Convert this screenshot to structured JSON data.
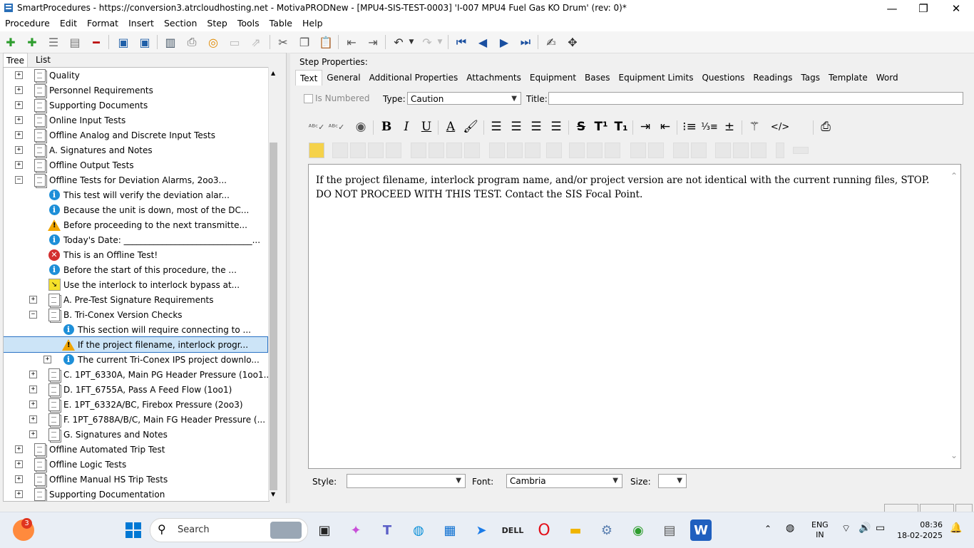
{
  "window": {
    "title": "SmartProcedures - https://conversion3.atrcloudhosting.net - MotivaPRODNew - [MPU4-SIS-TEST-0003] 'I-007 MPU4 Fuel Gas KO Drum' (rev: 0)*",
    "minimize": "—",
    "maximize": "❐",
    "close": "✕"
  },
  "menu": [
    "Procedure",
    "Edit",
    "Format",
    "Insert",
    "Section",
    "Step",
    "Tools",
    "Table",
    "Help"
  ],
  "left_tabs": {
    "tree": "Tree",
    "list": "List"
  },
  "tree": [
    {
      "label": "Quality",
      "level": 0,
      "icon": "doc",
      "exp": "+"
    },
    {
      "label": "Personnel Requirements",
      "level": 0,
      "icon": "doc",
      "exp": "+"
    },
    {
      "label": "Supporting Documents",
      "level": 0,
      "icon": "doc",
      "exp": "+"
    },
    {
      "label": "Online Input Tests",
      "level": 0,
      "icon": "doc",
      "exp": "+"
    },
    {
      "label": "Offline Analog and Discrete Input Tests",
      "level": 0,
      "icon": "doc",
      "exp": "+"
    },
    {
      "label": "A. Signatures and Notes",
      "level": 0,
      "icon": "doc",
      "exp": "+"
    },
    {
      "label": "Offline Output Tests",
      "level": 0,
      "icon": "doc",
      "exp": "+"
    },
    {
      "label": "Offline Tests for Deviation Alarms, 2oo3...",
      "level": 0,
      "icon": "doc",
      "exp": "−"
    },
    {
      "label": "This test will verify the deviation alar...",
      "level": 1,
      "icon": "info",
      "exp": ""
    },
    {
      "label": "Because the unit is down, most of the DC...",
      "level": 1,
      "icon": "info",
      "exp": ""
    },
    {
      "label": "Before proceeding to the next transmitte...",
      "level": 1,
      "icon": "warn",
      "exp": ""
    },
    {
      "label": "Today's Date: ______________________________...",
      "level": 1,
      "icon": "info",
      "exp": ""
    },
    {
      "label": "This is an Offline Test!",
      "level": 1,
      "icon": "err",
      "exp": ""
    },
    {
      "label": "Before the start of this procedure, the ...",
      "level": 1,
      "icon": "info",
      "exp": ""
    },
    {
      "label": "Use the interlock to interlock bypass at...",
      "level": 1,
      "icon": "bypass",
      "exp": ""
    },
    {
      "label": "A. Pre-Test Signature Requirements",
      "level": 1,
      "icon": "doc",
      "exp": "+"
    },
    {
      "label": "B. Tri-Conex Version Checks",
      "level": 1,
      "icon": "doc",
      "exp": "−"
    },
    {
      "label": "This section will require connecting to ...",
      "level": 2,
      "icon": "info",
      "exp": ""
    },
    {
      "label": "If the project filename, interlock progr...",
      "level": 2,
      "icon": "warn",
      "exp": "",
      "selected": true
    },
    {
      "label": "The current Tri-Conex IPS project downlo...",
      "level": 2,
      "icon": "info",
      "exp": "+"
    },
    {
      "label": "C. 1PT_6330A, Main PG Header Pressure (1oo1...",
      "level": 1,
      "icon": "doc",
      "exp": "+"
    },
    {
      "label": "D. 1FT_6755A, Pass A Feed Flow (1oo1)",
      "level": 1,
      "icon": "doc",
      "exp": "+"
    },
    {
      "label": "E. 1PT_6332A/BC, Firebox Pressure (2oo3)",
      "level": 1,
      "icon": "doc",
      "exp": "+"
    },
    {
      "label": "F. 1PT_6788A/B/C, Main FG Header Pressure (...",
      "level": 1,
      "icon": "doc",
      "exp": "+"
    },
    {
      "label": "G. Signatures and Notes",
      "level": 1,
      "icon": "doc",
      "exp": "+"
    },
    {
      "label": "Offline Automated Trip Test",
      "level": 0,
      "icon": "doc",
      "exp": "+"
    },
    {
      "label": "Offline Logic Tests",
      "level": 0,
      "icon": "doc",
      "exp": "+"
    },
    {
      "label": "Offline Manual HS Trip Tests",
      "level": 0,
      "icon": "doc",
      "exp": "+"
    },
    {
      "label": "Supporting Documentation",
      "level": 0,
      "icon": "doc",
      "exp": "+"
    }
  ],
  "step": {
    "heading": "Step Properties:",
    "tabs": [
      "Text",
      "General",
      "Additional Properties",
      "Attachments",
      "Equipment",
      "Bases",
      "Equipment Limits",
      "Questions",
      "Readings",
      "Tags",
      "Template",
      "Word"
    ],
    "is_numbered_label": "Is Numbered",
    "type_label": "Type:",
    "type_value": "Caution",
    "title_label": "Title:",
    "title_value": "",
    "body_text": "If the project filename, interlock program name, and/or project version are not identical with the current running files, STOP. DO NOT PROCEED WITH THIS TEST. Contact the SIS Focal Point.",
    "style_label": "Style:",
    "style_value": "",
    "font_label": "Font:",
    "font_value": "Cambria",
    "size_label": "Size:",
    "size_value": ""
  },
  "taskbar": {
    "search_placeholder": "Search",
    "badge": "3",
    "lang_top": "ENG",
    "lang_bottom": "IN",
    "time": "08:36",
    "date": "18-02-2025"
  },
  "colors": {
    "accent": "#0078d4",
    "selection": "#cce4f7",
    "info": "#1e8fd8",
    "warning": "#f0a500",
    "error": "#d32f2f"
  }
}
